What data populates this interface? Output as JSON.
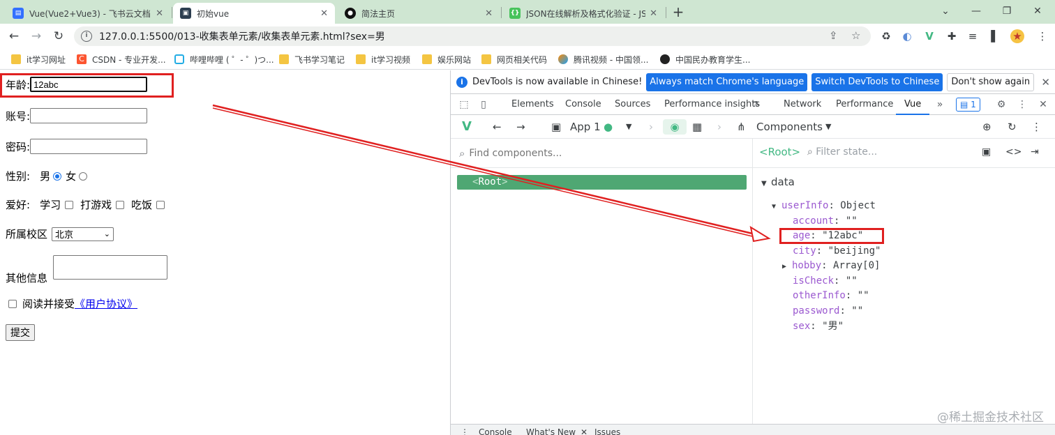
{
  "browser": {
    "tabs": [
      {
        "title": "Vue(Vue2+Vue3) - 飞书云文档",
        "favicon": "feishu-doc-icon",
        "color": "#3370ff"
      },
      {
        "title": "初始vue",
        "favicon": "vscode-icon",
        "color": "#2c3e50"
      },
      {
        "title": "简法主页",
        "favicon": "jianfa-icon",
        "color": "#111111"
      },
      {
        "title": "JSON在线解析及格式化验证 - JS",
        "favicon": "json-icon",
        "color": "#47c35b"
      }
    ],
    "new_tab": "+",
    "window_controls": [
      "⌄",
      "—",
      "❐",
      "✕"
    ],
    "url": "127.0.0.1:5500/013-收集表单元素/收集表单元素.html?sex=男",
    "bookmarks": [
      {
        "label": "it学习网址",
        "icon": "folder-icon"
      },
      {
        "label": "CSDN - 专业开发...",
        "icon": "csdn-icon"
      },
      {
        "label": "哔哩哔哩 ( ゜- ゜)つ...",
        "icon": "bilibili-icon"
      },
      {
        "label": "飞书学习笔记",
        "icon": "folder-icon"
      },
      {
        "label": "it学习视频",
        "icon": "folder-icon"
      },
      {
        "label": "娱乐网站",
        "icon": "folder-icon"
      },
      {
        "label": "网页相关代码",
        "icon": "folder-icon"
      },
      {
        "label": "腾讯视频 - 中国领...",
        "icon": "tencent-video-icon"
      },
      {
        "label": "中国民办教育学生...",
        "icon": "globe-icon"
      }
    ]
  },
  "form": {
    "age_label": "年龄:",
    "age_value": "12abc",
    "account_label": "账号:",
    "password_label": "密码:",
    "gender_label": "性别:",
    "male": "男",
    "female": "女",
    "hobby_label": "爱好:",
    "hobbies": [
      "学习",
      "打游戏",
      "吃饭"
    ],
    "campus_label": "所属校区",
    "campus_value": "北京",
    "other_label": "其他信息",
    "agree_text": "阅读并接受",
    "agree_link": "《用户协议》",
    "submit": "提交"
  },
  "devtools": {
    "info_text": "DevTools is now available in Chinese!",
    "btn_match": "Always match Chrome's language",
    "btn_switch": "Switch DevTools to Chinese",
    "btn_dismiss": "Don't show again",
    "tabs": [
      "Elements",
      "Console",
      "Sources",
      "Performance insights",
      "Network",
      "Performance",
      "Vue"
    ],
    "issues_count": "1",
    "vue": {
      "app_label": "App 1",
      "components_label": "Components",
      "find_placeholder": "Find components...",
      "root_label": "Root",
      "selected": "<Root>",
      "filter_placeholder": "Filter state...",
      "section": "data",
      "user_info_key": "userInfo",
      "user_info_type": "Object",
      "fields": [
        {
          "key": "account",
          "value": "\"\""
        },
        {
          "key": "age",
          "value": "\"12abc\""
        },
        {
          "key": "city",
          "value": "\"beijing\""
        },
        {
          "key": "hobby",
          "value": "Array[0]"
        },
        {
          "key": "isCheck",
          "value": "\"\""
        },
        {
          "key": "otherInfo",
          "value": "\"\""
        },
        {
          "key": "password",
          "value": "\"\""
        },
        {
          "key": "sex",
          "value": "\"男\""
        }
      ]
    },
    "drawer_tabs": [
      "Console",
      "What's New",
      "Issues"
    ],
    "watermark": "@稀土掘金技术社区"
  },
  "colors": {
    "tab_strip": "#cfe6d2",
    "vue_green": "#42b883",
    "root_row": "#4fa773",
    "highlight_red": "#e02020",
    "prop_key": "#9b59d0"
  }
}
